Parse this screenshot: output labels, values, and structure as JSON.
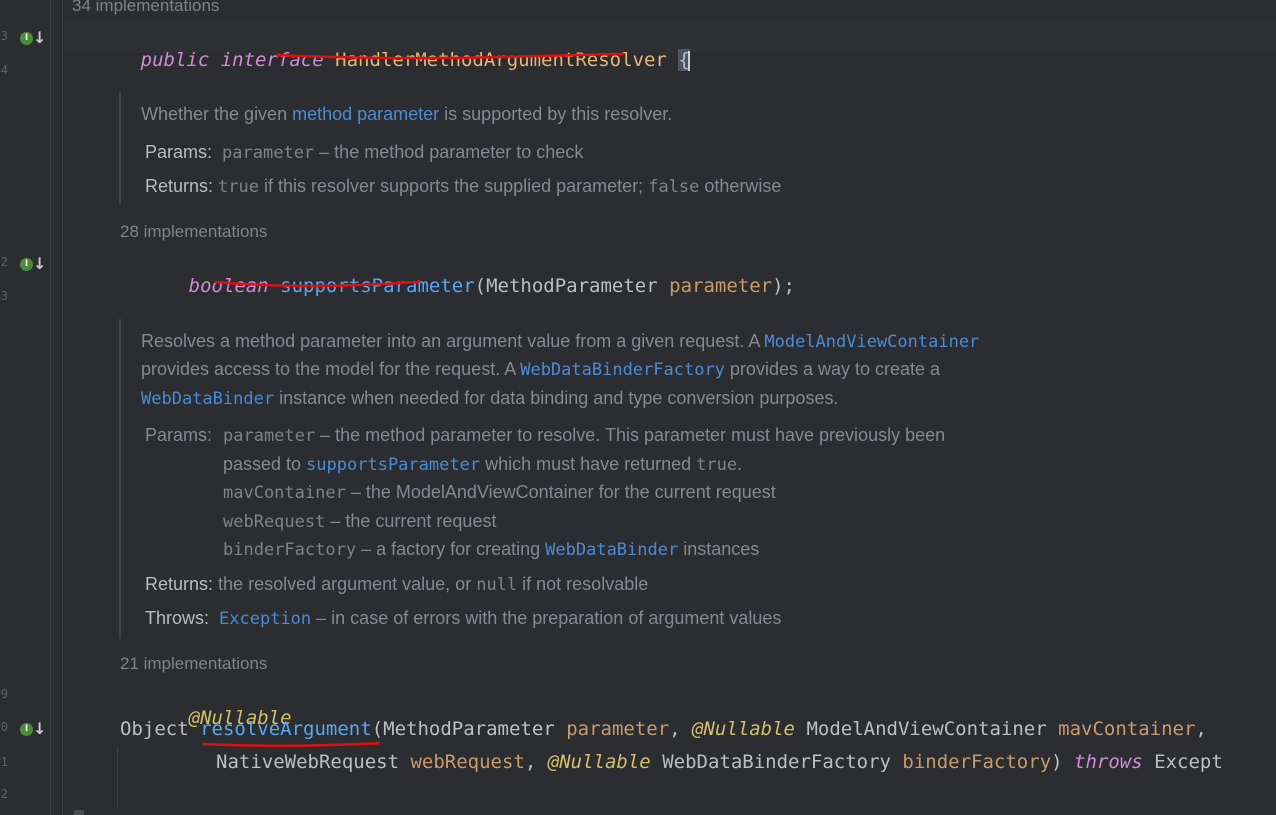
{
  "gutter": {
    "line_numbers": [
      "3",
      "4",
      "2",
      "3",
      "9",
      "0",
      "1",
      "2"
    ]
  },
  "implementations": {
    "interface": "34 implementations",
    "supports": "28 implementations",
    "resolve": "21 implementations"
  },
  "code": {
    "line1": {
      "kw1": "public",
      "kw2": "interface",
      "name": "HandlerMethodArgumentResolver",
      "brace": "{"
    },
    "line2": {
      "type": "boolean",
      "method": "supportsParameter",
      "open": "(",
      "ptype": "MethodParameter",
      "pname": "parameter",
      "close": ");"
    },
    "line3": {
      "ann": "@Nullable"
    },
    "line4": {
      "type": "Object",
      "method": "resolveArgument",
      "open": "(",
      "ptype1": "MethodParameter",
      "pname1": "parameter",
      "comma1": ",",
      "ann1": "@Nullable",
      "ptype2": "ModelAndViewContainer",
      "pname2": "mavContainer",
      "comma2": ","
    },
    "line5": {
      "ptype3": "NativeWebRequest",
      "pname3": "webRequest",
      "comma3": ",",
      "ann2": "@Nullable",
      "ptype4": "WebDataBinderFactory",
      "pname4": "binderFactory",
      "close": ")",
      "throws": "throws",
      "exc": "Except"
    }
  },
  "doc1": {
    "desc_a": "Whether the given ",
    "desc_link": "method parameter",
    "desc_b": " is supported by this resolver.",
    "params_label": "Params:",
    "param_name": "parameter",
    "param_desc": " – the method parameter to check",
    "returns_label": "Returns:",
    "ret_code1": "true",
    "ret_mid": " if this resolver supports the supplied parameter; ",
    "ret_code2": "false",
    "ret_end": " otherwise"
  },
  "doc2": {
    "l1a": "Resolves a method parameter into an argument value from a given request. A ",
    "l1link": "ModelAndViewContainer",
    "l2a": "provides access to the model for the request. A ",
    "l2link": "WebDataBinderFactory",
    "l2b": " provides a way to create a",
    "l3link": "WebDataBinder",
    "l3b": " instance when needed for data binding and type conversion purposes.",
    "params_label": "Params:",
    "p1name": "parameter",
    "p1desc": " – the method parameter to resolve. This parameter must have previously been",
    "p1b": "passed to ",
    "p1link": "supportsParameter",
    "p1c": " which must have returned ",
    "p1code": "true",
    "p1d": ".",
    "p2name": "mavContainer",
    "p2desc": " – the ModelAndViewContainer for the current request",
    "p3name": "webRequest",
    "p3desc": " – the current request",
    "p4name": "binderFactory",
    "p4desc": " – a factory for creating ",
    "p4link": "WebDataBinder",
    "p4end": " instances",
    "returns_label": "Returns:",
    "ret_a": "the resolved argument value, or ",
    "ret_code": "null",
    "ret_b": " if not resolvable",
    "throws_label": "Throws:",
    "throws_link": "Exception",
    "throws_desc": " – in case of errors with the preparation of argument values"
  },
  "colors": {
    "background": "#2b2d30",
    "keyword": "#cf8bd6",
    "method": "#56a8f5",
    "interface_name": "#e6b673",
    "parameter": "#c99a6a",
    "annotation": "#d4bf6a",
    "annotation_underline": "#e01010"
  },
  "icons": [
    "implemented-interface-icon",
    "implemented-method-icon"
  ]
}
